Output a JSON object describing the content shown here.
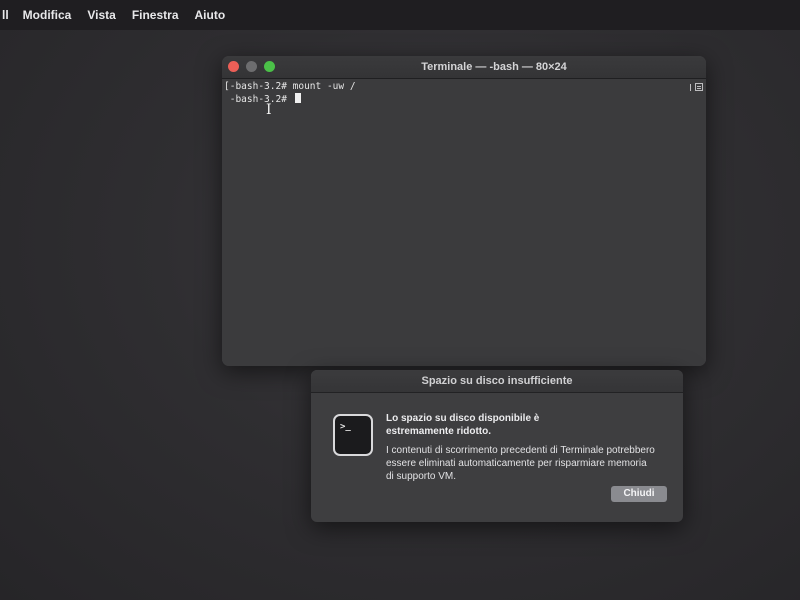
{
  "menubar": {
    "items": [
      {
        "label": "Modifica"
      },
      {
        "label": "Vista"
      },
      {
        "label": "Finestra"
      },
      {
        "label": "Aiuto"
      }
    ],
    "edge_glyph": "ll"
  },
  "terminal": {
    "title": "Terminale — -bash — 80×24",
    "lines": [
      "[-bash-3.2# mount -uw /",
      " -bash-3.2# "
    ],
    "buttons": {
      "close": "close-icon",
      "minimize": "minimize-icon",
      "zoom": "zoom-icon"
    },
    "colors": {
      "close": "#ec5f57",
      "minimize": "#6d6d6f",
      "zoom": "#4bc048"
    }
  },
  "alert": {
    "title": "Spazio su disco insufficiente",
    "heading": "Lo spazio su disco disponibile è estremamente ridotto.",
    "message": "I contenuti di scorrimento precedenti di Terminale potrebbero essere eliminati automaticamente per risparmiare memoria di supporto VM.",
    "icon": "terminal-app-icon",
    "icon_prompt": ">_",
    "button_label": "Chiudi"
  }
}
